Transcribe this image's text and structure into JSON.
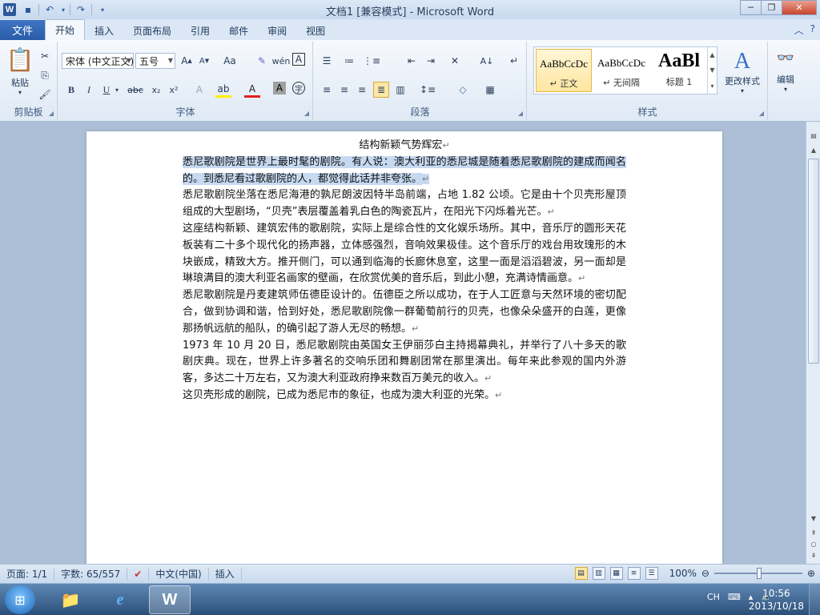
{
  "window": {
    "title": "文档1 [兼容模式] - Microsoft Word",
    "app_icon_letter": "W"
  },
  "tabs": {
    "file": "文件",
    "items": [
      "开始",
      "插入",
      "页面布局",
      "引用",
      "邮件",
      "审阅",
      "视图"
    ],
    "active": "开始"
  },
  "ribbon": {
    "clipboard": {
      "label": "剪贴板",
      "paste": "粘贴"
    },
    "font": {
      "label": "字体",
      "font_name": "宋体 (中文正文)",
      "font_size": "五号"
    },
    "paragraph": {
      "label": "段落"
    },
    "styles": {
      "label": "样式",
      "tiles": [
        {
          "sample": "AaBbCcDc",
          "name": "↵ 正文"
        },
        {
          "sample": "AaBbCcDc",
          "name": "↵ 无间隔"
        },
        {
          "sample": "AaBl",
          "name": "标题 1"
        }
      ],
      "change_styles": "更改样式"
    },
    "editing": {
      "label": "编辑"
    }
  },
  "document": {
    "title": "结构新颖气势辉宏",
    "para1": "悉尼歌剧院是世界上最时髦的剧院。有人说：澳大利亚的悉尼城是随着悉尼歌剧院的建成而闻名的。到悉尼看过歌剧院的人，都觉得此话并非夸张。",
    "para2": "悉尼歌剧院坐落在悉尼海港的孰尼朗波因特半岛前端，占地 1.82 公顷。它是由十个贝壳形屋顶组成的大型剧场，“贝壳”表层覆盖着乳白色的陶瓷瓦片，在阳光下闪烁着光芒。",
    "para3": "这座结构新颖、建筑宏伟的歌剧院，实际上是综合性的文化娱乐场所。其中，音乐厅的圆形天花板装有二十多个现代化的扬声器，立体感强烈，音响效果极佳。这个音乐厅的戏台用玫瑰形的木块嵌成，精致大方。推开侧门，可以通到临海的长廊休息室，这里一面是滔滔碧波，另一面却是琳琅满目的澳大利亚名画家的壁画，在欣赏优美的音乐后，到此小憩，充满诗情画意。",
    "para4": "悉尼歌剧院是丹麦建筑师伍德臣设计的。伍德臣之所以成功，在于人工匠意与天然环境的密切配合，做到协调和谐，恰到好处，悉尼歌剧院像一群葡萄前行的贝壳，也像朵朵盛开的白莲，更像那扬帆远航的船队，的确引起了游人无尽的畅想。",
    "para5": "1973 年 10 月 20 日，悉尼歌剧院由英国女王伊丽莎白主持揭幕典礼，并举行了八十多天的歌剧庆典。现在，世界上许多著名的交响乐团和舞剧团常在那里演出。每年来此参观的国内外游客，多达二十万左右，又为澳大利亚政府挣来数百万美元的收入。",
    "para6": "这贝壳形成的剧院，已成为悉尼市的象征，也成为澳大利亚的光荣。",
    "para_mark": "↵"
  },
  "status": {
    "page": "页面: 1/1",
    "words": "字数: 65/557",
    "language": "中文(中国)",
    "mode": "插入",
    "zoom": "100%"
  },
  "taskbar": {
    "ime": "CH",
    "time": "10:56",
    "date": "2013/10/18"
  }
}
